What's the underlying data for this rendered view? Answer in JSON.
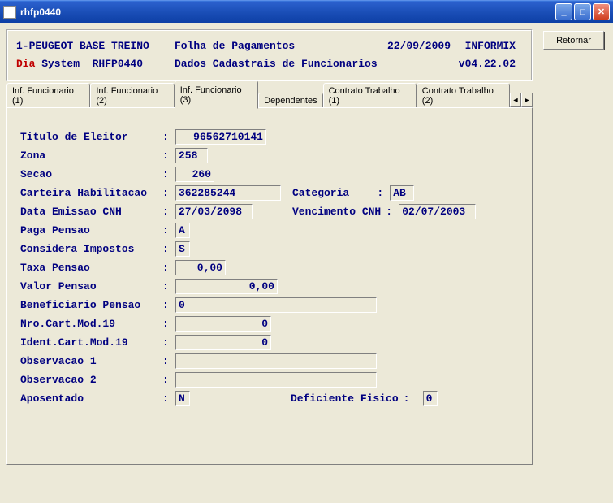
{
  "window": {
    "title": "rhfp0440",
    "min_tip": "Minimize",
    "max_tip": "Maximize",
    "close_tip": "Close"
  },
  "sidebar": {
    "retornar": "Retornar"
  },
  "header": {
    "line1_left": "1-PEUGEOT BASE TREINO",
    "line1_mid": "Folha de Pagamentos",
    "line1_date": "22/09/2009",
    "line1_sys": "INFORMIX",
    "line2_dia": "Dia",
    "line2_sys": " System  RHFP0440",
    "line2_mid": "Dados Cadastrais de Funcionarios",
    "line2_ver": "v04.22.02"
  },
  "tabs": {
    "t1": "Inf. Funcionario (1)",
    "t2": "Inf. Funcionario (2)",
    "t3": "Inf. Funcionario (3)",
    "t4": "Dependentes",
    "t5": "Contrato Trabalho (1)",
    "t6": "Contrato Trabalho (2)",
    "left": "◄",
    "right": "►"
  },
  "form": {
    "titulo_eleitor": {
      "label": "Titulo de Eleitor",
      "value": "96562710141"
    },
    "zona": {
      "label": "Zona",
      "value": "258"
    },
    "secao": {
      "label": "Secao",
      "value": "260"
    },
    "carteira_hab": {
      "label": "Carteira Habilitacao",
      "value": "362285244"
    },
    "categoria": {
      "label": "Categoria",
      "value": "AB"
    },
    "data_emissao_cnh": {
      "label": "Data Emissao CNH",
      "value": "27/03/2098"
    },
    "vencimento_cnh": {
      "label": "Vencimento CNH",
      "value": "02/07/2003"
    },
    "paga_pensao": {
      "label": "Paga Pensao",
      "value": "A"
    },
    "considera_impostos": {
      "label": "Considera Impostos",
      "value": "S"
    },
    "taxa_pensao": {
      "label": "Taxa Pensao",
      "value": "0,00"
    },
    "valor_pensao": {
      "label": "Valor Pensao",
      "value": "0,00"
    },
    "beneficiario_pensao": {
      "label": "Beneficiario Pensao",
      "value": "0"
    },
    "nro_cart_mod19": {
      "label": "Nro.Cart.Mod.19",
      "value": "0"
    },
    "ident_cart_mod19": {
      "label": "Ident.Cart.Mod.19",
      "value": "0"
    },
    "observacao1": {
      "label": "Observacao 1",
      "value": ""
    },
    "observacao2": {
      "label": "Observacao 2",
      "value": ""
    },
    "aposentado": {
      "label": "Aposentado",
      "value": "N"
    },
    "deficiente_fisico": {
      "label": "Deficiente Fisico",
      "value": "0"
    }
  }
}
